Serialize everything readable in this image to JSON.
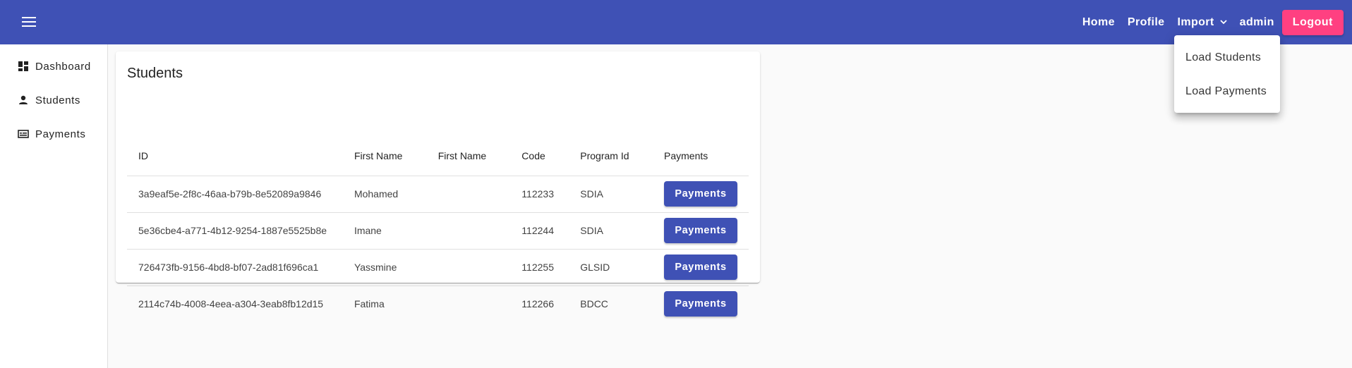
{
  "header": {
    "menu_icon": "hamburger-menu-icon",
    "links": {
      "home": "Home",
      "profile": "Profile",
      "import": "Import",
      "user": "admin"
    },
    "import_icon": "chevron-down-icon",
    "logout": "Logout",
    "colors": {
      "toolbar": "#3f51b5",
      "logout": "#ff4081"
    }
  },
  "import_menu": {
    "items": [
      "Load Students",
      "Load Payments"
    ]
  },
  "sidebar": {
    "items": [
      {
        "label": "Dashboard",
        "icon": "dashboard-icon"
      },
      {
        "label": "Students",
        "icon": "person-icon"
      },
      {
        "label": "Payments",
        "icon": "payments-icon"
      }
    ]
  },
  "students": {
    "title": "Students",
    "columns": [
      "ID",
      "First Name",
      "First Name",
      "Code",
      "Program Id",
      "Payments"
    ],
    "rows": [
      {
        "id": "3a9eaf5e-2f8c-46aa-b79b-8e52089a9846",
        "first_name": "Mohamed",
        "last_name": "",
        "code": "112233",
        "program_id": "SDIA",
        "action": "Payments"
      },
      {
        "id": "5e36cbe4-a771-4b12-9254-1887e5525b8e",
        "first_name": "Imane",
        "last_name": "",
        "code": "112244",
        "program_id": "SDIA",
        "action": "Payments"
      },
      {
        "id": "726473fb-9156-4bd8-bf07-2ad81f696ca1",
        "first_name": "Yassmine",
        "last_name": "",
        "code": "112255",
        "program_id": "GLSID",
        "action": "Payments"
      },
      {
        "id": "2114c74b-4008-4eea-a304-3eab8fb12d15",
        "first_name": "Fatima",
        "last_name": "",
        "code": "112266",
        "program_id": "BDCC",
        "action": "Payments"
      }
    ]
  }
}
